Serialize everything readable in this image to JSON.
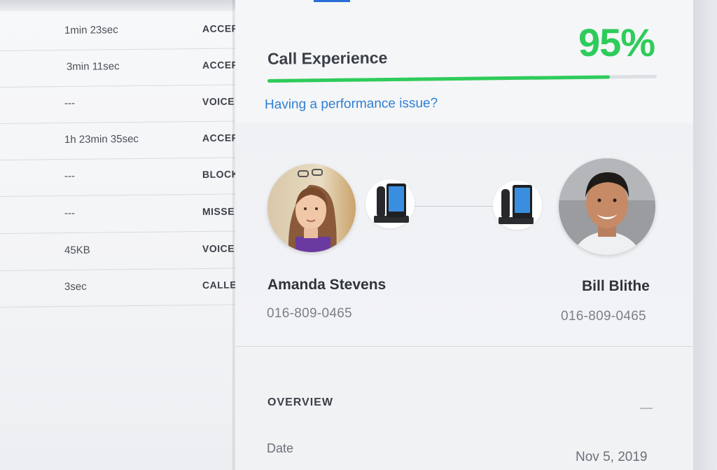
{
  "call_log": {
    "rows": [
      {
        "value": "1min 23sec",
        "status": "ACCEP"
      },
      {
        "value": "3min 11sec",
        "status": "ACCEP"
      },
      {
        "value": "---",
        "status": "VOICE"
      },
      {
        "value": "1h 23min 35sec",
        "status": "ACCEP"
      },
      {
        "value": "---",
        "status": "BLOCK"
      },
      {
        "value": "---",
        "status": "MISSE"
      },
      {
        "value": "45KB",
        "status": "VOICE"
      },
      {
        "value": "3sec",
        "status": "CALLE"
      }
    ]
  },
  "call_experience": {
    "title": "Call Experience",
    "score_text": "95%",
    "score_fraction": 0.88,
    "link_text": "Having a performance issue?"
  },
  "caller": {
    "name": "Amanda Stevens",
    "number": "016-809-0465"
  },
  "callee": {
    "name": "Bill Blithe",
    "number": "016-809-0465"
  },
  "overview": {
    "title": "OVERVIEW",
    "date_label": "Date",
    "date_value": "Nov 5, 2019"
  },
  "colors": {
    "accent_green": "#2ecc5a",
    "link_blue": "#2f7fd0",
    "tab_blue": "#2b6fd6"
  },
  "icons": [
    "desk-phone-icon",
    "collapse-icon"
  ]
}
